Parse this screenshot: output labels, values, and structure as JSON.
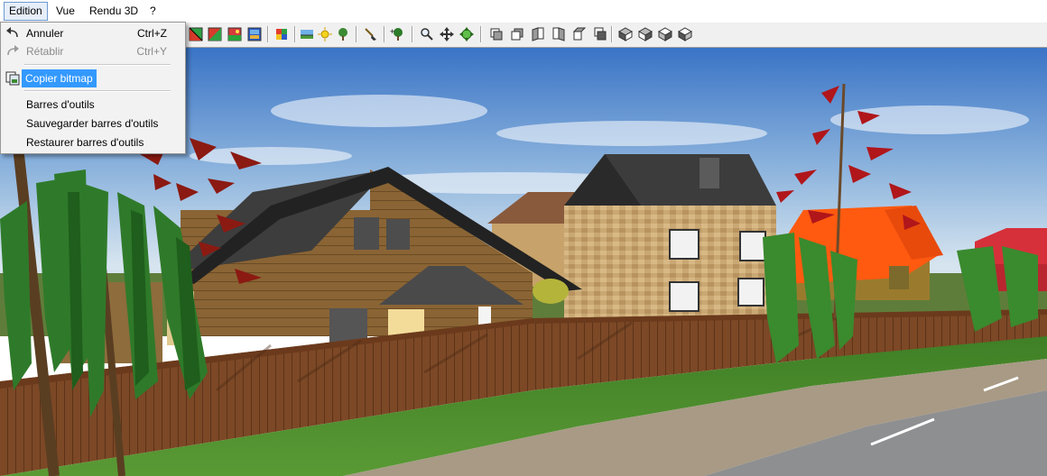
{
  "menubar": {
    "items": [
      {
        "label": "Edition"
      },
      {
        "label": "Vue"
      },
      {
        "label": "Rendu 3D"
      },
      {
        "label": "?"
      }
    ]
  },
  "edit_menu": {
    "undo": {
      "label": "Annuler",
      "shortcut": "Ctrl+Z"
    },
    "redo": {
      "label": "Rétablir",
      "shortcut": "Ctrl+Y"
    },
    "copy_bitmap": {
      "label": "Copier bitmap"
    },
    "toolbars": {
      "label": "Barres d'outils"
    },
    "save_toolbars": {
      "label": "Sauvegarder barres d'outils"
    },
    "restore_toolbars": {
      "label": "Restaurer barres d'outils"
    }
  },
  "toolbar": {
    "buttons": [
      "texture-red-green-icon",
      "texture-stripes-icon",
      "landscape-image-icon",
      "color-palette-icon",
      "sky-icon",
      "sun-icon",
      "tree-small-icon",
      "brush-icon",
      "tree-add-icon",
      "zoom-icon",
      "pan-icon",
      "rotate-icon",
      "view-front-icon",
      "view-back-icon",
      "view-left-icon",
      "view-right-icon",
      "view-top-icon",
      "view-bottom-icon",
      "iso-ne-icon",
      "iso-nw-icon",
      "iso-se-icon",
      "iso-sw-icon"
    ]
  },
  "colors": {
    "menu_highlight": "#3399ff",
    "sky_top": "#3f78c8",
    "sky_bottom": "#cfe0ee",
    "grass": "#4c8a2c",
    "fence": "#7a4a26",
    "road": "#8d8e8f"
  }
}
